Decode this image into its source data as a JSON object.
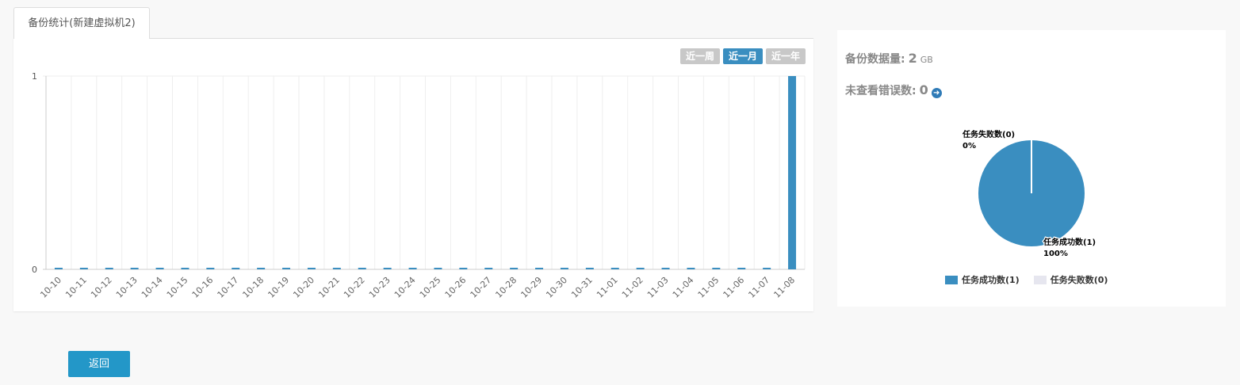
{
  "tab": {
    "label": "备份统计(新建虚拟机2)"
  },
  "range_buttons": [
    {
      "label": "近一周",
      "active": false
    },
    {
      "label": "近一月",
      "active": true
    },
    {
      "label": "近一年",
      "active": false
    }
  ],
  "summary": {
    "backup_size_label": "备份数据量:",
    "backup_size_value": "2",
    "backup_size_unit": "GB",
    "unviewed_errors_label": "未查看错误数:",
    "unviewed_errors_value": "0"
  },
  "legend": [
    {
      "label": "任务成功数(1)",
      "color": "#3a8ec0"
    },
    {
      "label": "任务失败数(0)",
      "color": "#e6e6ef"
    }
  ],
  "pie_labels": {
    "failed_name": "任务失败数(0)",
    "failed_pct": "0%",
    "success_name": "任务成功数(1)",
    "success_pct": "100%"
  },
  "colors": {
    "accent": "#3a8ec0",
    "button": "#2397c8",
    "inactive": "#c8c8c8"
  },
  "back_button": {
    "label": "返回"
  },
  "chart_data": [
    {
      "type": "bar",
      "categories": [
        "10-10",
        "10-11",
        "10-12",
        "10-13",
        "10-14",
        "10-15",
        "10-16",
        "10-17",
        "10-18",
        "10-19",
        "10-20",
        "10-21",
        "10-22",
        "10-23",
        "10-24",
        "10-25",
        "10-26",
        "10-27",
        "10-28",
        "10-29",
        "10-30",
        "10-31",
        "11-01",
        "11-02",
        "11-03",
        "11-04",
        "11-05",
        "11-06",
        "11-07",
        "11-08"
      ],
      "values": [
        0,
        0,
        0,
        0,
        0,
        0,
        0,
        0,
        0,
        0,
        0,
        0,
        0,
        0,
        0,
        0,
        0,
        0,
        0,
        0,
        0,
        0,
        0,
        0,
        0,
        0,
        0,
        0,
        0,
        1
      ],
      "yticks": [
        "0",
        "1"
      ],
      "ylim": [
        0,
        1
      ],
      "grid": true,
      "color": "#3a8ec0"
    },
    {
      "type": "pie",
      "slices": [
        {
          "label": "任务成功数(1)",
          "value": 1,
          "percent": "100%",
          "color": "#3a8ec0"
        },
        {
          "label": "任务失败数(0)",
          "value": 0,
          "percent": "0%",
          "color": "#e6e6ef"
        }
      ]
    }
  ]
}
